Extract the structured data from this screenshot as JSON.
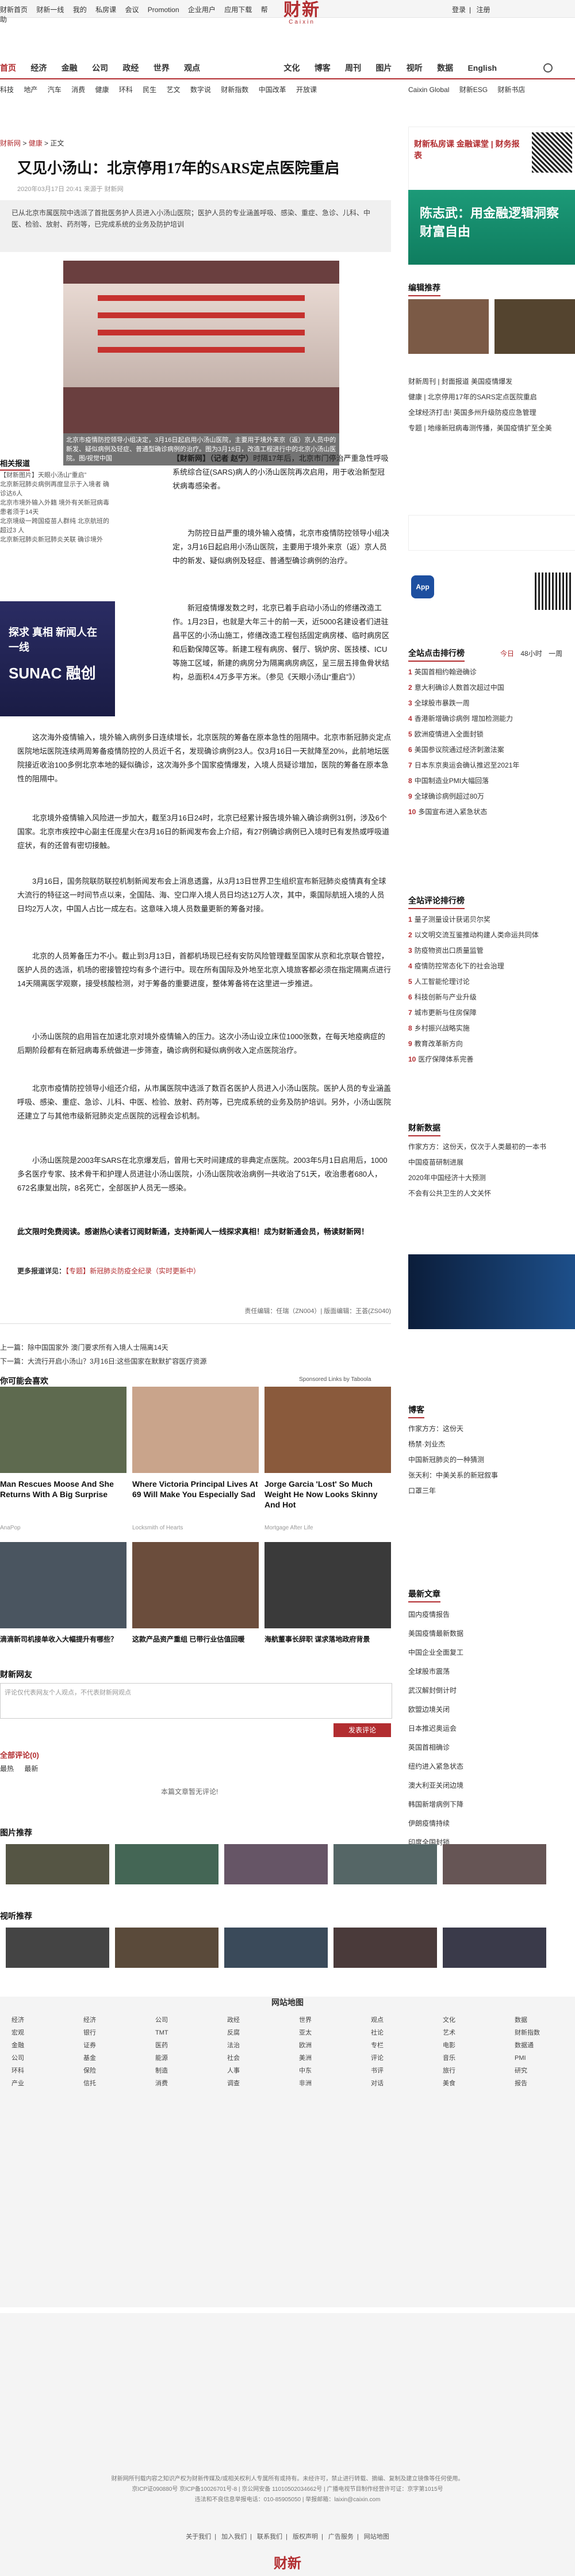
{
  "topbar": {
    "links": [
      "财新首页",
      "财新一线",
      "我的",
      "私房课",
      "会议",
      "Promotion",
      "企业用户",
      "应用下载",
      "帮助"
    ],
    "login": "登录",
    "register": "注册"
  },
  "logo": {
    "cn": "财新",
    "en": "Caixin"
  },
  "mainnav": {
    "items": [
      "首页",
      "经济",
      "金融",
      "公司",
      "政经",
      "世界",
      "观点",
      "文化",
      "博客",
      "周刊",
      "图片",
      "视听",
      "数据",
      "English"
    ]
  },
  "subnav": {
    "left": [
      "科技",
      "地产",
      "汽车",
      "消费",
      "健康",
      "环科",
      "民生",
      "艺文",
      "数字说",
      "财新指数",
      "中国改革",
      "开放课"
    ],
    "right": [
      "Caixin Global",
      "财新ESG",
      "财新书店"
    ]
  },
  "breadcrumb": {
    "site": "财新网",
    "sep": " > ",
    "section": "健康",
    "page": "正文"
  },
  "article": {
    "title": "又见小汤山：北京停用17年的SARS定点医院重启",
    "meta": "2020年03月17日 20:41  来源于 财新网",
    "summary": "已从北京市属医院中选派了首批医务护人员进入小汤山医院；医护人员的专业涵盖呼吸、感染、重症、急诊、儿科、中医、检验、放射、药剂等，已完成系统的业务及防护培训",
    "hero_caption": "北京市疫情防控领导小组决定，3月16日起启用小汤山医院，主要用于境外来京（返）京人员中的新发、疑似病例及轻症、普通型确诊病例的治疗。图为3月16日，改造工程进行中的北京小汤山医院。图/视觉中国",
    "author_line": "【财新网】（记者 赵宁）",
    "paragraphs": [
      "时隔17年后，北京市门停治严重急性呼吸系统综合征(SARS)病人的小汤山医院再次启用，用于收治新型冠状病毒感染者。",
      "为防控日益严重的境外输入疫情，北京市疫情防控领导小组决定，3月16日起启用小汤山医院，主要用于境外来京（返）京人员中的新发、疑似病例及轻症、普通型确诊病例的治疗。",
      "新冠疫情爆发数之时，北京已着手启动小汤山的修缮改造工作。1月23日，也就是大年三十的前一天，近5000名建设者们进驻昌平区的小汤山施工，修缮改造工程包括固定病房楼、临时病房区和后勤保障区等。新建工程有病房、餐厅、锅炉房、医技楼、ICU等施工区域，新建的病房分为隔离病房病区，呈三层五排鱼骨状结构，总面积4.4万多平方米。（参见《天眼小汤山“重启”》）",
      "这次海外疫情输入，境外输入病例多日连续增长，北京医院的筹备在原本急性的阻隔中。北京市新冠肺炎定点医院地坛医院连续两周筹备疫情防控的人员近千名，发现确诊病例23人。仅3月16日一天就降至20%，此前地坛医院接近收治100多例北京本地的疑似确诊，这次海外多个国家疫情爆发，入境人员疑诊增加，医院的筹备在原本急性的阻隔中。",
      "北京境外疫情输入风险进一步加大，截至3月16日24时，北京已经累计报告境外输入确诊病例31例，涉及6个国家。北京市疾控中心副主任庞星火在3月16日的新闻发布会上介绍，有27例确诊病例已入境时已有发热或呼吸道症状，有的还曾有密切接触。",
      "3月16日，国务院联防联控机制新闻发布会上消息透露，从3月13日世界卫生组织宣布新冠肺炎疫情真有全球大流行的特征这一时间节点以来，全国陆、海、空口岸入境人员日均达12万人次，其中，乘国际航班入境的人员日均2万人次，中国人占比一成左右。这意味入境人员数量更新的筹备对接。",
      "北京的人员筹备压力不小。截止到3月13日，首都机场现已经有安防风险管理截至国家从京和北京联合管控，医护人员的选派，机场的密接管控均有多个进行中。现在所有国际及外地至北京入境旅客都必须在指定隔离点进行14天隔离医学观察，接受核酸检测，对于筹备的重要进度，整体筹备将在这里进一步推进。",
      "小汤山医院的启用旨在加速北京对境外疫情输入的压力。这次小汤山设立床位1000张数，在每天地疫病症的后期阶段都有在新冠病毒系统做进一步筛查，确诊病例和疑似病例收入定点医院治疗。",
      "北京市疫情防控领导小组还介绍，从市属医院中选派了数百名医护人员进入小汤山医院。医护人员的专业涵盖呼吸、感染、重症、急诊、儿科、中医、检验、放射、药剂等，已完成系统的业务及防护培训。另外，小汤山医院还建立了与其他市级新冠肺炎定点医院的远程会诊机制。",
      "小汤山医院是2003年SARS在北京爆发后，曾用七天时间建成的非典定点医院。2003年5月1日启用后，1000多名医疗专家、技术骨干和护理人员进驻小汤山医院，小汤山医院收治病例一共收治了51天，收治患者680人，672名康复出院，8名死亡，全部医护人员无一感染。"
    ],
    "notice": "此文限时免费阅读。感谢热心读者订阅财新通，支持新闻人一线探求真相！成为财新通会员，畅读财新网！",
    "more_reading_label": "更多报道详见：",
    "more_reading_link": "【专题】新冠肺炎防疫全纪录（实时更新中）",
    "editor": "责任编辑：任瑞（ZN004）| 版面编辑：王荟(ZS040)",
    "prev": "上一篇：除中国国家外 澳门要求所有入境人士隔离14天",
    "next": "下一篇：大流行开启小汤山？3月16日:这些国家在默默扩容医疗资源"
  },
  "left": {
    "related_title": "相关报道",
    "related": [
      "【财新图片】天眼小汤山“重启”",
      "北京新冠肺炎病例再度显示于入境者 确诊达6人",
      "北京市境外输入外籍 境外有关新冠病毒患者须于14天",
      "北京境级一跨国疫苗人群纯 北京航班的超过3 人",
      "北京新冠肺炎新冠肺炎关联 确诊境外"
    ],
    "ad_text": "探求 真相 新闻人在一线",
    "ad_brand": "SUNAC 融创"
  },
  "right": {
    "ad_top": "财新私房课 金融课堂 | 财务报表",
    "ad_green": "陈志武：用金融逻辑洞察财富自由",
    "editor_pick_title": "编辑推荐",
    "editor_picks": [
      "财新周刊 | 封面报道 美国疫情爆发",
      "健康 | 北京停用17年的SARS定点医院重启",
      "全球经济打击! 英国多州升级防疫应急管理",
      "专题 | 地缘新冠病毒测传播，美国疫情扩至全美"
    ],
    "app_label": "App",
    "hot_title": "全站点击排行榜",
    "hot_tabs": [
      "今日",
      "48小时",
      "一周"
    ],
    "hot_list": [
      "英国首相约翰逊确诊",
      "意大利确诊人数首次超过中国",
      "全球股市暴跌一周",
      "香港新增确诊病例 增加检测能力",
      "欧洲疫情进入全面封锁",
      "美国参议院通过经济刺激法案",
      "日本东京奥运会确认推迟至2021年",
      "中国制造业PMI大幅回落",
      "全球确诊病例超过80万",
      "多国宣布进入紧急状态"
    ],
    "comment_title": "全站评论排行榜",
    "comment_list": [
      "量子测量设计获诺贝尔奖",
      "以文明交流互鉴推动构建人类命运共同体",
      "防疫物资出口质量监管",
      "疫情防控常态化下的社会治理",
      "人工智能伦理讨论",
      "科技创新与产业升级",
      "城市更新与住房保障",
      "乡村振兴战略实施",
      "教育改革新方向",
      "医疗保障体系完善"
    ],
    "finance_title": "财新数据",
    "finance_list": [
      "作家方方：这份天，仅次于人类最初的一本书",
      "中国疫苗研制进展",
      "2020年中国经济十大预测",
      "不会有公共卫生的人文关怀"
    ],
    "blog_title": "博客",
    "blog_list": [
      "作家方方：这份天",
      "杨禁·刘业杰",
      "中国新冠肺炎的一种猜测",
      "张天利：中美关系的新冠叙事",
      "口罩三年"
    ],
    "news_title": "最新文章",
    "news_list": [
      "国内疫情报告",
      "美国疫情最新数据",
      "中国企业全面复工",
      "全球股市震荡",
      "武汉解封倒计时",
      "欧盟边境关闭",
      "日本推迟奥运会",
      "英国首相确诊",
      "纽约进入紧急状态",
      "澳大利亚关闭边境",
      "韩国新增病例下降",
      "伊朗疫情持续",
      "印度全国封锁"
    ]
  },
  "bottom": {
    "recommend_title": "你可能会喜欢",
    "sponsored": "Sponsored Links by Taboola",
    "cards": [
      {
        "title": "Man Rescues Moose And She Returns With A Big Surprise",
        "src": "AnaPop"
      },
      {
        "title": "Where Victoria Principal Lives At 69 Will Make You Especially Sad",
        "src": "Locksmith of Hearts"
      },
      {
        "title": "Jorge Garcia 'Lost' So Much Weight He Now Looks Skinny And Hot",
        "src": "Mortgage After Life"
      }
    ],
    "cards2": [
      {
        "title": "滴滴新司机接单收入大幅提升有哪些？"
      },
      {
        "title": "这款产品资产重组 已带行业估值回暖"
      },
      {
        "title": "海航董事长辞职 谋求落地政府背景"
      }
    ],
    "comments_head": "财新网友",
    "comment_placeholder": "评论仅代表网友个人观点，不代表财新网观点",
    "comment_submit": "发表评论",
    "all_comments": "全部评论(0)",
    "comments_tabs": [
      "最热",
      "最新"
    ],
    "no_comments": "本篇文章暂无评论!",
    "pic_title": "图片推荐",
    "video_title": "视听推荐",
    "footer_title": "网站地图",
    "footer_cols": [
      [
        "经济",
        "宏观",
        "金融",
        "公司",
        "环科",
        "产业"
      ],
      [
        "经济",
        "银行",
        "证券",
        "基金",
        "保险",
        "信托"
      ],
      [
        "公司",
        "TMT",
        "医药",
        "能源",
        "制造",
        "消费"
      ],
      [
        "政经",
        "反腐",
        "法治",
        "社会",
        "人事",
        "调查"
      ],
      [
        "世界",
        "亚太",
        "欧洲",
        "美洲",
        "中东",
        "非洲"
      ],
      [
        "观点",
        "社论",
        "专栏",
        "评论",
        "书评",
        "对话"
      ],
      [
        "文化",
        "艺术",
        "电影",
        "音乐",
        "旅行",
        "美食"
      ],
      [
        "数据",
        "财新指数",
        "数据通",
        "PMI",
        "研究",
        "报告"
      ]
    ],
    "footer_copyright": "财新网所刊载内容之知识产权为财新传媒及/或相关权利人专属所有或持有。未经许可，禁止进行转载、摘编、复制及建立镜像等任何使用。",
    "footer_icp": "京ICP证090880号 京ICP备10026701号-8 | 京公网安备 11010502034662号 | 广播电视节目制作经营许可证：京字第1015号",
    "footer_contact": "违法和不良信息举报电话：010-85905050 | 举报邮箱：laixin@caixin.com",
    "footer_links": [
      "关于我们",
      "加入我们",
      "联系我们",
      "版权声明",
      "广告服务",
      "网站地图"
    ]
  }
}
